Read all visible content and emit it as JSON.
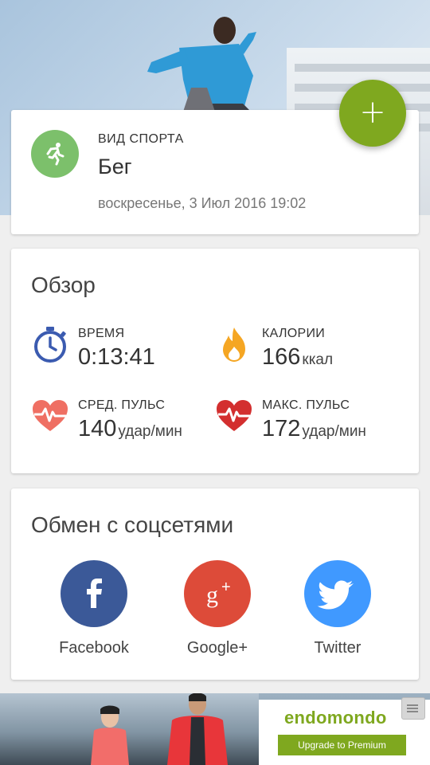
{
  "fab": {
    "icon": "plus-icon",
    "label": "+"
  },
  "sport": {
    "label": "ВИД СПОРТА",
    "value": "Бег",
    "date": "воскресенье, 3 Июл 2016 19:02",
    "icon": "running-icon",
    "icon_color": "#7cc06b"
  },
  "overview": {
    "title": "Обзор",
    "stats": [
      {
        "label": "ВРЕМЯ",
        "value": "0:13:41",
        "unit": "",
        "icon": "stopwatch-icon"
      },
      {
        "label": "КАЛОРИИ",
        "value": "166",
        "unit": "ккал",
        "icon": "flame-icon"
      },
      {
        "label": "СРЕД. ПУЛЬС",
        "value": "140",
        "unit": "удар/мин",
        "icon": "heart-pulse-icon"
      },
      {
        "label": "МАКС. ПУЛЬС",
        "value": "172",
        "unit": "удар/мин",
        "icon": "heart-pulse-max-icon"
      }
    ]
  },
  "social": {
    "title": "Обмен с соцсетями",
    "items": [
      {
        "name": "Facebook",
        "color": "#3b5998",
        "icon": "facebook-icon"
      },
      {
        "name": "Google+",
        "color": "#dd4b39",
        "icon": "google-plus-icon"
      },
      {
        "name": "Twitter",
        "color": "#4099ff",
        "icon": "twitter-icon"
      }
    ]
  },
  "ad": {
    "brand": "endomondo",
    "button": "Upgrade to Premium"
  },
  "colors": {
    "accent": "#7fa81f",
    "stopwatch": "#3b5bb0",
    "flame": "#f5a623",
    "heart_avg": "#ef6f63",
    "heart_max": "#d32f2f"
  }
}
